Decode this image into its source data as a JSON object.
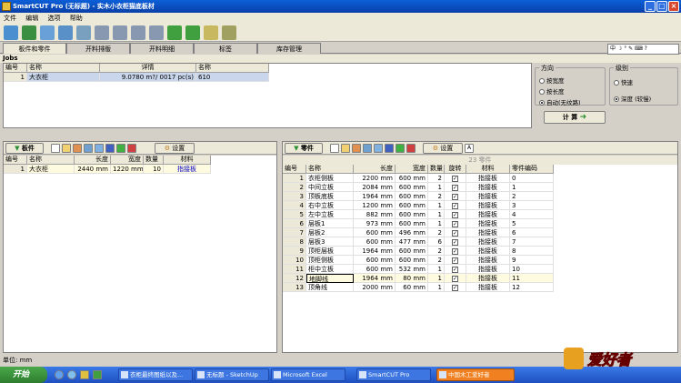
{
  "window": {
    "title": "SmartCUT Pro (无标题)  - 实木小衣柜猫底板材"
  },
  "menu": [
    "文件",
    "编辑",
    "选项",
    "帮助"
  ],
  "tabs": [
    "板件和零件",
    "开料排版",
    "开料明细",
    "标签",
    "库存管理"
  ],
  "ime_text": "中 ☽ ° ✎ ⌨ ?",
  "jobs": {
    "title": "Jobs",
    "headers": [
      "编号",
      "名称",
      "详情",
      "名称"
    ],
    "row": {
      "num": "1",
      "name": "大衣柜",
      "detail": "9.0780 m?/ 0017 pc(s)",
      "extra": "610"
    }
  },
  "direction": {
    "label": "方向",
    "options": [
      "按宽度",
      "按长度",
      "自动(无纹路)"
    ],
    "selected": 2
  },
  "level": {
    "label": "级别",
    "options": [
      "快速",
      "深度 (较慢)"
    ],
    "selected": 1
  },
  "calc_label": "计 算",
  "boards": {
    "label": "板件",
    "settings_label": "设置",
    "headers": [
      "编号",
      "名称",
      "长度",
      "宽度",
      "数量",
      "材料"
    ],
    "rows": [
      {
        "num": "1",
        "name": "大衣柜",
        "len": "2440 mm",
        "wid": "1220 mm",
        "qty": "10",
        "mat": "指接板"
      }
    ]
  },
  "parts": {
    "label": "零件",
    "settings_label": "设置",
    "count_label": "23 零件",
    "headers": [
      "编号",
      "名称",
      "长度",
      "宽度",
      "数量",
      "旋转",
      "材料",
      "零件编码"
    ],
    "rows": [
      {
        "num": "1",
        "name": "衣柜侧板",
        "len": "2200 mm",
        "wid": "600 mm",
        "qty": "2",
        "mat": "指接板",
        "code": "0"
      },
      {
        "num": "2",
        "name": "中间立板",
        "len": "2084 mm",
        "wid": "600 mm",
        "qty": "1",
        "mat": "指接板",
        "code": "1"
      },
      {
        "num": "3",
        "name": "顶板底板",
        "len": "1964 mm",
        "wid": "600 mm",
        "qty": "2",
        "mat": "指接板",
        "code": "2"
      },
      {
        "num": "4",
        "name": "右中立板",
        "len": "1200 mm",
        "wid": "600 mm",
        "qty": "1",
        "mat": "指接板",
        "code": "3"
      },
      {
        "num": "5",
        "name": "左中立板",
        "len": "882 mm",
        "wid": "600 mm",
        "qty": "1",
        "mat": "指接板",
        "code": "4"
      },
      {
        "num": "6",
        "name": "层板1",
        "len": "973 mm",
        "wid": "600 mm",
        "qty": "1",
        "mat": "指接板",
        "code": "5"
      },
      {
        "num": "7",
        "name": "层板2",
        "len": "600 mm",
        "wid": "496 mm",
        "qty": "2",
        "mat": "指接板",
        "code": "6"
      },
      {
        "num": "8",
        "name": "层板3",
        "len": "600 mm",
        "wid": "477 mm",
        "qty": "6",
        "mat": "指接板",
        "code": "7"
      },
      {
        "num": "9",
        "name": "顶柜层板",
        "len": "1964 mm",
        "wid": "600 mm",
        "qty": "2",
        "mat": "指接板",
        "code": "8"
      },
      {
        "num": "10",
        "name": "顶柜侧板",
        "len": "600 mm",
        "wid": "600 mm",
        "qty": "2",
        "mat": "指接板",
        "code": "9"
      },
      {
        "num": "11",
        "name": "柜中立板",
        "len": "600 mm",
        "wid": "532 mm",
        "qty": "1",
        "mat": "指接板",
        "code": "10"
      },
      {
        "num": "12",
        "name": "地脚线",
        "len": "1964 mm",
        "wid": "80 mm",
        "qty": "1",
        "mat": "指接板",
        "code": "11"
      },
      {
        "num": "13",
        "name": "顶角线",
        "len": "2000 mm",
        "wid": "60 mm",
        "qty": "1",
        "mat": "指接板",
        "code": "12"
      }
    ]
  },
  "status": {
    "text": "单位: mm"
  },
  "taskbar": {
    "start": "开始",
    "items": [
      "衣柜最终图纸以及...",
      "无标题 - SketchUp",
      "Microsoft Excel",
      "SmartCUT Pro",
      "中国木工爱好者"
    ]
  },
  "watermark": "爱好者",
  "colors": {
    "title": "#0a3fa8",
    "selected": "#fffbe0",
    "taskbar": "#2b5fd8",
    "material": "#0000c0"
  }
}
